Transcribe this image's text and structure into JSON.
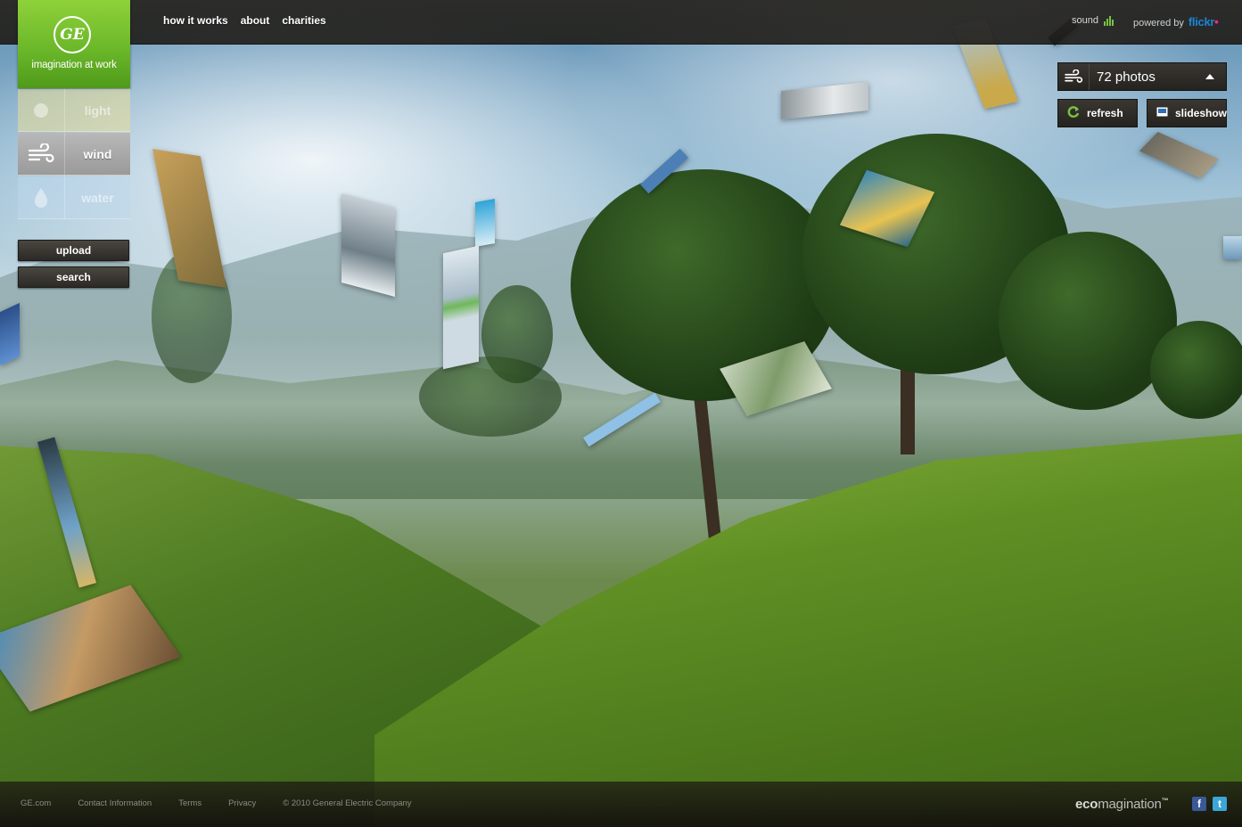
{
  "nav": {
    "how_it_works": "how it works",
    "about": "about",
    "charities": "charities"
  },
  "audio": {
    "label": "sound",
    "icon": "sound-bars-icon"
  },
  "powered": {
    "label": "powered by",
    "brand_part1": "flickr",
    "brand_part2": ""
  },
  "logo": {
    "mark": "GE",
    "tagline": "imagination at work"
  },
  "elements": [
    {
      "id": "light",
      "label": "light",
      "icon": "sun-icon",
      "active": false
    },
    {
      "id": "wind",
      "label": "wind",
      "icon": "wind-icon",
      "active": true
    },
    {
      "id": "water",
      "label": "water",
      "icon": "water-drop-icon",
      "active": false
    }
  ],
  "actions": {
    "upload": "upload",
    "search": "search"
  },
  "photos_panel": {
    "count_label": "72 photos",
    "refresh": "refresh",
    "slideshow": "slideshow"
  },
  "footer": {
    "links": [
      "GE.com",
      "Contact Information",
      "Terms",
      "Privacy"
    ],
    "copyright": "© 2010 General Electric Company",
    "brand_a": "eco",
    "brand_b": "magination",
    "brand_tm": "™"
  },
  "colors": {
    "ge_green": "#6cb82a",
    "flickr_blue": "#1c84d6",
    "flickr_pink": "#ff2a8c",
    "refresh_green": "#7ac142",
    "facebook": "#3b5998",
    "twitter": "#3ba6d8"
  }
}
